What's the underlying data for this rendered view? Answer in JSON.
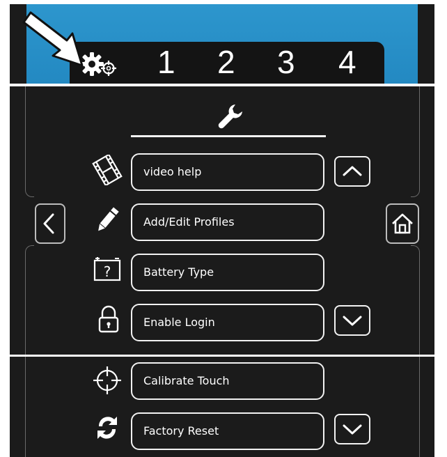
{
  "tab_bar": {
    "settings_icon": "gears-icon",
    "pointer_icon": "arrow-pointer-icon",
    "tabs": [
      "1",
      "2",
      "3",
      "4"
    ]
  },
  "menu": {
    "header_icon": "wrench-icon",
    "items": [
      {
        "label": "video help",
        "icon": "film-icon"
      },
      {
        "label": "Add/Edit Profiles",
        "icon": "pencil-icon"
      },
      {
        "label": "Battery Type",
        "icon": "battery-question-icon"
      },
      {
        "label": "Enable Login",
        "icon": "lock-icon"
      }
    ],
    "scroll_up_icon": "chevron-up-icon",
    "scroll_down_icon": "chevron-down-icon",
    "back_icon": "chevron-left-icon",
    "home_icon": "home-icon"
  },
  "menu_scrolled": {
    "items": [
      {
        "label": "Calibrate Touch",
        "icon": "crosshair-icon"
      },
      {
        "label": "Factory Reset",
        "icon": "refresh-icon"
      }
    ],
    "scroll_down_icon": "chevron-down-icon"
  },
  "colors": {
    "sky": "#2389c2",
    "panel": "#1b1b1b",
    "outline": "#f2f2f2",
    "text": "#ffffff"
  }
}
